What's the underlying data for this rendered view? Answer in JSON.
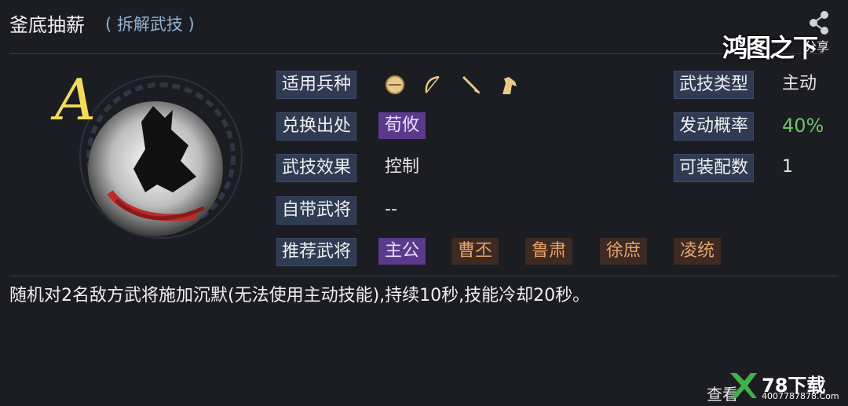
{
  "header": {
    "title": "釜底抽薪",
    "subtitle": "( 拆解武技 )",
    "share_label": "分享",
    "brand": "鸿图之下"
  },
  "skill": {
    "grade": "A",
    "fields": {
      "unit_types_label": "适用兵种",
      "exchange_source_label": "兑换出处",
      "exchange_source_value": "荀攸",
      "effect_label": "武技效果",
      "effect_value": "控制",
      "own_general_label": "自带武将",
      "own_general_value": "--",
      "recommended_label": "推荐武将",
      "skill_type_label": "武技类型",
      "skill_type_value": "主动",
      "trigger_rate_label": "发动概率",
      "trigger_rate_value": "40%",
      "equip_count_label": "可装配数",
      "equip_count_value": "1"
    },
    "unit_icons": [
      "shield-icon",
      "bow-icon",
      "spear-icon",
      "horse-icon"
    ],
    "recommended": [
      {
        "name": "主公",
        "style": "purple"
      },
      {
        "name": "曹丕",
        "style": "orange"
      },
      {
        "name": "鲁肃",
        "style": "orange"
      },
      {
        "name": "徐庶",
        "style": "orange"
      },
      {
        "name": "凌统",
        "style": "orange"
      }
    ],
    "description": "随机对2名敌方武将施加沉默(无法使用主动技能),持续10秒,技能冷却20秒。"
  },
  "footer": {
    "view_label": "查看",
    "watermark_main": "78下载",
    "watermark_sub": "4007787878.Com"
  },
  "colors": {
    "background": "#1c1d22",
    "label_bg": "#2e3b52",
    "purple_tag": "#5b3a8c",
    "orange_tag_text": "#e8a36a",
    "trigger_rate_green": "#6fc36a",
    "grade_gold": "#f2dc5a"
  }
}
